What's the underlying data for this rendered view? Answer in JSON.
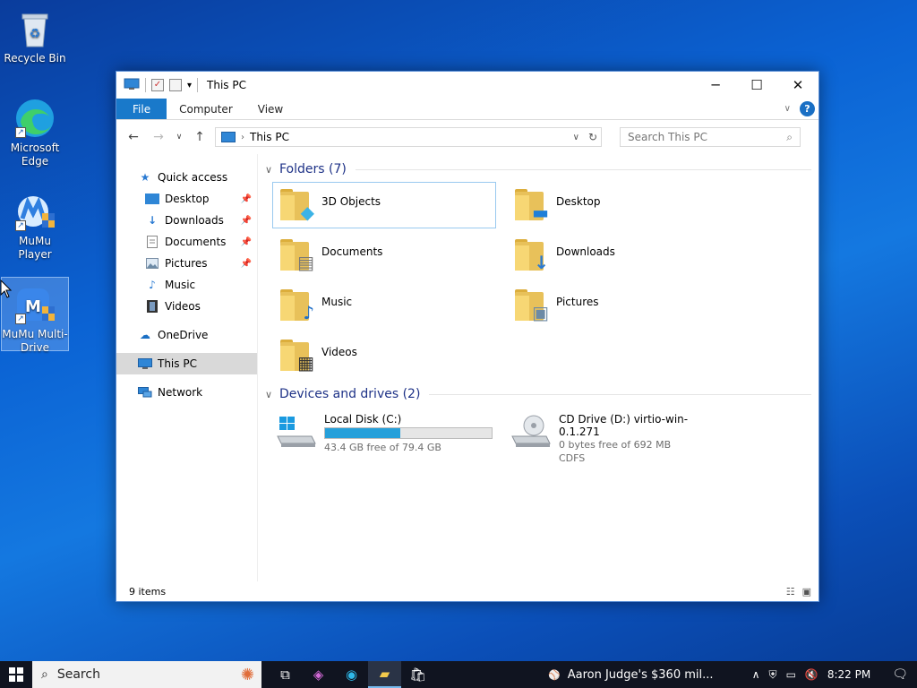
{
  "desktop": {
    "icons": [
      {
        "label": "Recycle Bin"
      },
      {
        "label": "Microsoft Edge"
      },
      {
        "label": "MuMu Player"
      },
      {
        "label": "MuMu Multi-Drive"
      }
    ]
  },
  "window": {
    "title": "This PC",
    "ribbon_tabs": [
      "File",
      "Computer",
      "View"
    ],
    "address": "This PC",
    "search_placeholder": "Search This PC",
    "nav": {
      "quick_access": "Quick access",
      "quick_items": [
        "Desktop",
        "Downloads",
        "Documents",
        "Pictures",
        "Music",
        "Videos"
      ],
      "onedrive": "OneDrive",
      "this_pc": "This PC",
      "network": "Network"
    },
    "folders_header": "Folders (7)",
    "folders": [
      "3D Objects",
      "Desktop",
      "Documents",
      "Downloads",
      "Music",
      "Pictures",
      "Videos"
    ],
    "drives_header": "Devices and drives (2)",
    "drives": [
      {
        "name": "Local Disk (C:)",
        "free": "43.4 GB free of 79.4 GB",
        "used_fraction": 0.45
      },
      {
        "name": "CD Drive (D:) virtio-win-0.1.271",
        "free": "0 bytes free of 692 MB",
        "fs": "CDFS"
      }
    ],
    "status": "9 items",
    "colors": {
      "accent": "#1979ca",
      "bar_fill": "#26a0da",
      "folder": "#e8c15a"
    }
  },
  "taskbar": {
    "search": "Search",
    "news": "Aaron Judge's $360 mil...",
    "time": "8:22 PM"
  }
}
